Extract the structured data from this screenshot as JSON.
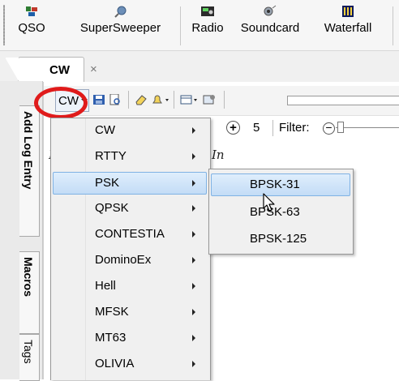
{
  "ribbon": {
    "buttons": [
      {
        "label": "QSO",
        "icon": "qso-icon"
      },
      {
        "label": "SuperSweeper",
        "icon": "supersweeper-icon"
      },
      {
        "label": "Radio",
        "icon": "radio-icon"
      },
      {
        "label": "Soundcard",
        "icon": "soundcard-icon"
      },
      {
        "label": "Waterfall",
        "icon": "waterfall-icon"
      }
    ]
  },
  "tabs": {
    "active": {
      "label": "CW",
      "close": "×"
    }
  },
  "side_tabs": [
    {
      "label": "Add Log Entry"
    },
    {
      "label": "Macros"
    },
    {
      "label": "Tags"
    }
  ],
  "toolbar": {
    "mode_button": "CW"
  },
  "controls": {
    "step_value": "5",
    "filter_label": "Filter:"
  },
  "text_area": {
    "fragment_left": "I",
    "fragment_right": "In"
  },
  "mode_menu": {
    "items": [
      {
        "label": "CW"
      },
      {
        "label": "RTTY"
      },
      {
        "label": "PSK",
        "highlighted": true
      },
      {
        "label": "QPSK"
      },
      {
        "label": "CONTESTIA"
      },
      {
        "label": "DominoEx"
      },
      {
        "label": "Hell"
      },
      {
        "label": "MFSK"
      },
      {
        "label": "MT63"
      },
      {
        "label": "OLIVIA"
      }
    ]
  },
  "psk_submenu": {
    "items": [
      {
        "label": "BPSK-31",
        "highlighted": true
      },
      {
        "label": "BPSK-63"
      },
      {
        "label": "BPSK-125"
      }
    ]
  },
  "colors": {
    "highlight_circle": "#e01b1b",
    "menu_highlight": "#c3dcf6"
  }
}
